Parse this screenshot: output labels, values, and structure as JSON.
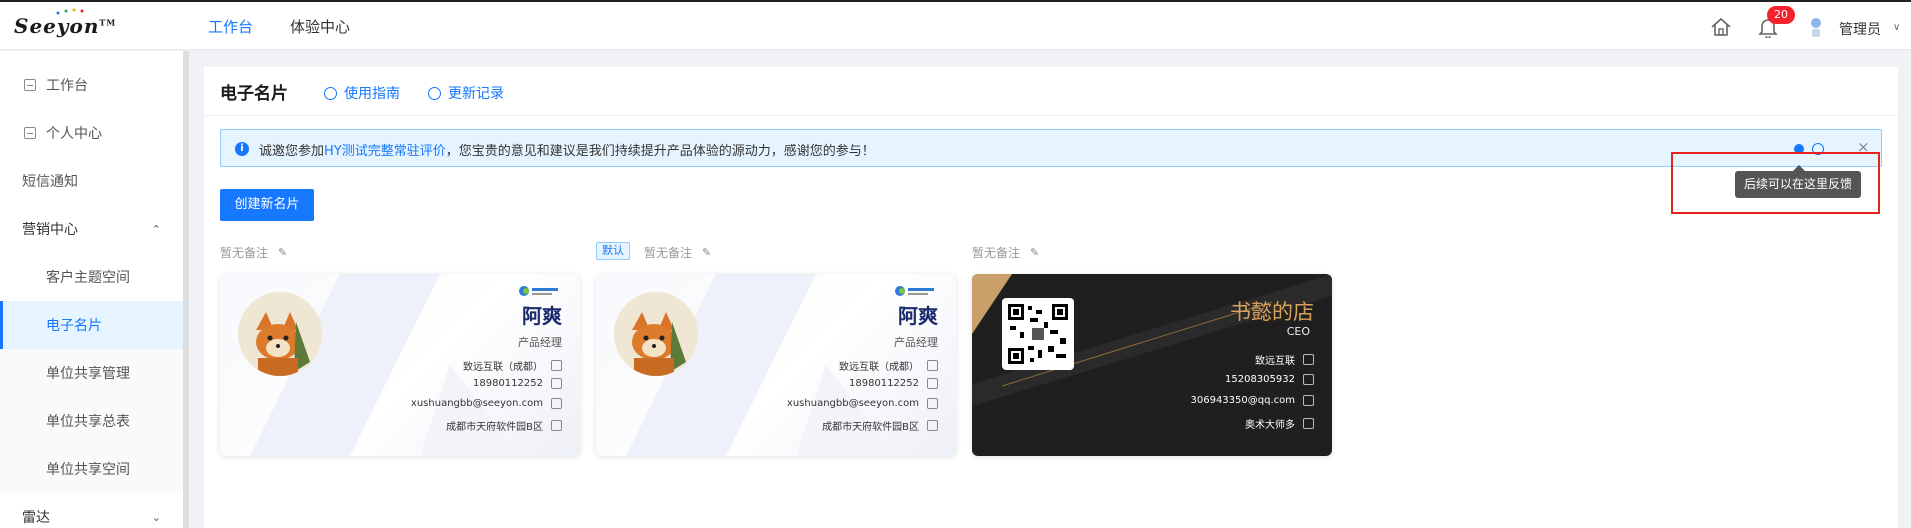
{
  "header": {
    "logo_text": "Seeyon",
    "logo_tm": "TM",
    "nav": [
      {
        "label": "工作台",
        "active": true
      },
      {
        "label": "体验中心",
        "active": false
      }
    ],
    "notification_count": "20",
    "user_name": "管理员",
    "icons": [
      "home-icon",
      "bell-icon",
      "user-avatar-icon",
      "chevron-down-icon"
    ]
  },
  "sidebar": {
    "items": [
      {
        "label": "工作台",
        "icon": "workbench-icon"
      },
      {
        "label": "个人中心",
        "icon": "profile-icon"
      },
      {
        "label": "短信通知"
      },
      {
        "label": "营销中心",
        "expanded": true
      },
      {
        "label": "客户主题空间"
      },
      {
        "label": "电子名片",
        "active": true
      },
      {
        "label": "单位共享管理"
      },
      {
        "label": "单位共享总表"
      },
      {
        "label": "单位共享空间"
      },
      {
        "label": "雷达",
        "expanded": false
      }
    ],
    "chevron_up": "⌃",
    "chevron_down": "⌄"
  },
  "page": {
    "title": "电子名片",
    "guide_link": "使用指南",
    "update_link": "更新记录"
  },
  "notice": {
    "prefix": "诚邀您参加",
    "link": "HY测试完整常驻评价",
    "suffix": "，您宝贵的意见和建议是我们持续提升产品体验的源动力，感谢您的参与！",
    "close": "×"
  },
  "tooltip": "后续可以在这里反馈",
  "create_button": "创建新名片",
  "cards": [
    {
      "remark": "暂无备注",
      "is_default": false,
      "name": "阿爽",
      "title": "产品经理",
      "company": "致远互联（成都）",
      "phone": "18980112252",
      "email": "xushuangbb@seeyon.com",
      "address": "成都市天府软件园B区"
    },
    {
      "remark": "暂无备注",
      "is_default": true,
      "default_label": "默认",
      "name": "阿爽",
      "title": "产品经理",
      "company": "致远互联（成都）",
      "phone": "18980112252",
      "email": "xushuangbb@seeyon.com",
      "address": "成都市天府软件园B区"
    },
    {
      "remark": "暂无备注",
      "is_default": false,
      "name": "书懿的店",
      "title": "CEO",
      "company": "致远互联",
      "phone": "15208305932",
      "email": "306943350@qq.com",
      "address": "奥术大师多"
    }
  ],
  "colors": {
    "accent": "#1677ff",
    "badge": "#f5222d",
    "highlight": "#e8221f",
    "gold": "#d9a25a"
  }
}
